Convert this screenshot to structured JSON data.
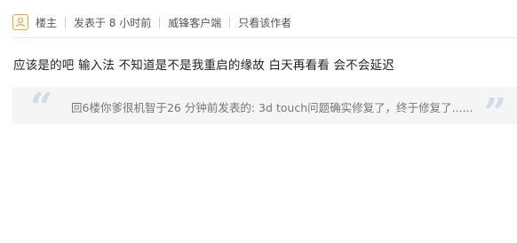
{
  "post_meta": {
    "author_label": "楼主",
    "posted_time": "发表于 8 小时前",
    "client": "威锋客户端",
    "only_author_label": "只看该作者"
  },
  "post_content": "应该是的吧 输入法 不知道是不是我重启的缘故 白天再看看 会不会延迟",
  "quote": {
    "open_mark": "“",
    "close_mark": "”",
    "text": "回6楼你爹很机智于26 分钟前发表的: 3d touch问题确实修复了，终于修复了......"
  },
  "colors": {
    "accent_icon": "#e8a53b",
    "quote_mark": "#d2dbe6",
    "quote_bg": "#f5f5f5"
  },
  "icons": {
    "author_badge": "louzhu-icon"
  }
}
